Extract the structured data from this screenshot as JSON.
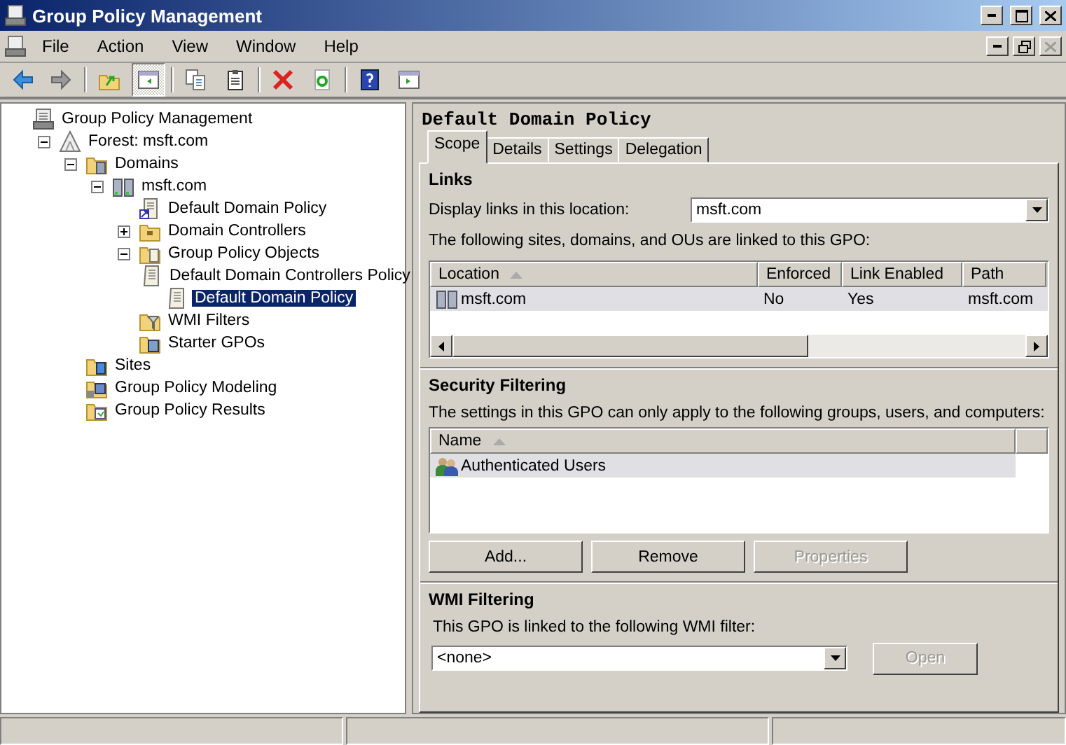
{
  "window": {
    "title": "Group Policy Management"
  },
  "menu": [
    "File",
    "Action",
    "View",
    "Window",
    "Help"
  ],
  "toolbar": [
    [
      {
        "kind": "back",
        "pressed": false
      },
      {
        "kind": "forward",
        "pressed": false
      }
    ],
    [
      {
        "kind": "up",
        "pressed": false
      },
      {
        "kind": "pane",
        "pressed": true
      }
    ],
    [
      {
        "kind": "copy",
        "pressed": false
      },
      {
        "kind": "paste",
        "pressed": false
      }
    ],
    [
      {
        "kind": "delete",
        "pressed": false
      },
      {
        "kind": "refresh",
        "pressed": false
      }
    ],
    [
      {
        "kind": "help",
        "pressed": false
      },
      {
        "kind": "action-pane",
        "pressed": false
      }
    ]
  ],
  "tree": [
    {
      "label": "Group Policy Management",
      "kind": "console",
      "selected": false,
      "children": [
        {
          "label": "Forest: msft.com",
          "kind": "forest",
          "selected": false,
          "expanded": true,
          "children": [
            {
              "label": "Domains",
              "kind": "domains",
              "selected": false,
              "expanded": true,
              "children": [
                {
                  "label": "msft.com",
                  "kind": "domain",
                  "selected": false,
                  "expanded": true,
                  "children": [
                    {
                      "label": "Default Domain Policy",
                      "kind": "link",
                      "selected": false
                    },
                    {
                      "label": "Domain Controllers",
                      "kind": "folder",
                      "selected": false,
                      "expanded": false
                    },
                    {
                      "label": "Group Policy Objects",
                      "kind": "container",
                      "selected": false,
                      "expanded": true,
                      "children": [
                        {
                          "label": "Default Domain Controllers Policy",
                          "kind": "policy",
                          "selected": false
                        },
                        {
                          "label": "Default Domain Policy",
                          "kind": "policy",
                          "selected": true
                        }
                      ]
                    },
                    {
                      "label": "WMI Filters",
                      "kind": "filters",
                      "selected": false
                    },
                    {
                      "label": "Starter GPOs",
                      "kind": "starter",
                      "selected": false
                    }
                  ]
                }
              ]
            },
            {
              "label": "Sites",
              "kind": "sites",
              "selected": false
            },
            {
              "label": "Group Policy Modeling",
              "kind": "modeling",
              "selected": false
            },
            {
              "label": "Group Policy Results",
              "kind": "results",
              "selected": false
            }
          ]
        }
      ]
    }
  ],
  "details": {
    "title": "Default Domain Policy",
    "tabs": [
      {
        "label": "Scope",
        "selected": true
      },
      {
        "label": "Details",
        "selected": false
      },
      {
        "label": "Settings",
        "selected": false
      },
      {
        "label": "Delegation",
        "selected": false
      }
    ],
    "links": {
      "heading": "Links",
      "location_label": "Display links in this location:",
      "location_value": "msft.com",
      "note": "The following sites, domains, and OUs are linked to this GPO:",
      "columns": [
        "Location",
        "Enforced",
        "Link Enabled",
        "Path"
      ],
      "rows": [
        {
          "cells": [
            "msft.com",
            "No",
            "Yes",
            "msft.com"
          ],
          "selected": true
        }
      ]
    },
    "security": {
      "heading": "Security Filtering",
      "note": "The settings in this GPO can only apply to the following groups, users, and computers:",
      "columns": [
        "Name"
      ],
      "rows": [
        {
          "name": "Authenticated Users",
          "selected": true
        }
      ],
      "buttons": [
        {
          "label": "Add...",
          "disabled": false
        },
        {
          "label": "Remove",
          "disabled": false
        },
        {
          "label": "Properties",
          "disabled": true
        }
      ]
    },
    "wmi": {
      "heading": "WMI Filtering",
      "note": "This GPO is linked to the following WMI filter:",
      "value": "<none>",
      "button": {
        "label": "Open",
        "disabled": true
      }
    }
  }
}
